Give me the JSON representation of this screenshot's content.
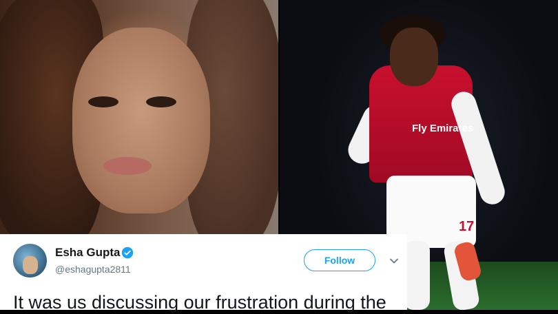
{
  "tweet": {
    "author_name": "Esha Gupta",
    "author_handle": "@eshagupta2811",
    "follow_label": "Follow",
    "text": "It was us discussing our frustration during the"
  },
  "jersey": {
    "sponsor": "Fly Emirates",
    "number": "17"
  },
  "colors": {
    "twitter_blue": "#1da1f2",
    "text_primary": "#14171a",
    "text_secondary": "#657786"
  },
  "icons": [
    "verified-badge-icon",
    "chevron-down-icon"
  ]
}
